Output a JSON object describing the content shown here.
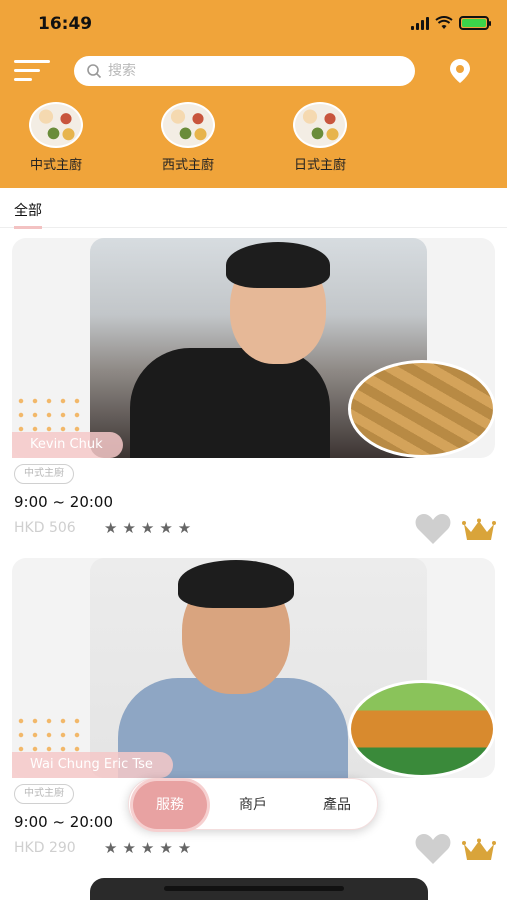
{
  "status_bar": {
    "time": "16:49"
  },
  "search": {
    "placeholder": "搜索"
  },
  "categories": [
    {
      "label": "中式主廚"
    },
    {
      "label": "西式主廚"
    },
    {
      "label": "日式主廚"
    }
  ],
  "tabs": {
    "all": "全部"
  },
  "chefs": [
    {
      "name": "Kevin Chuk",
      "category": "中式主廚",
      "hours": "9:00 ~ 20:00",
      "price": "HKD 506",
      "stars": "★★★★★",
      "rating": 5
    },
    {
      "name": "Wai Chung Eric Tse",
      "category": "中式主廚",
      "hours": "9:00 ~ 20:00",
      "price": "HKD 290",
      "stars": "★★★★★",
      "rating": 5
    }
  ],
  "bottom_nav": {
    "items": [
      "服務",
      "商戶",
      "產品"
    ],
    "active": "服務"
  },
  "colors": {
    "header": "#f0a43a",
    "accent_pink": "#e8a2a2",
    "crown": "#d9a43a"
  },
  "icons": {
    "menu": "hamburger-icon",
    "search": "search-icon",
    "location": "location-pin-icon",
    "favorite": "heart-icon",
    "rank": "crown-icon"
  }
}
